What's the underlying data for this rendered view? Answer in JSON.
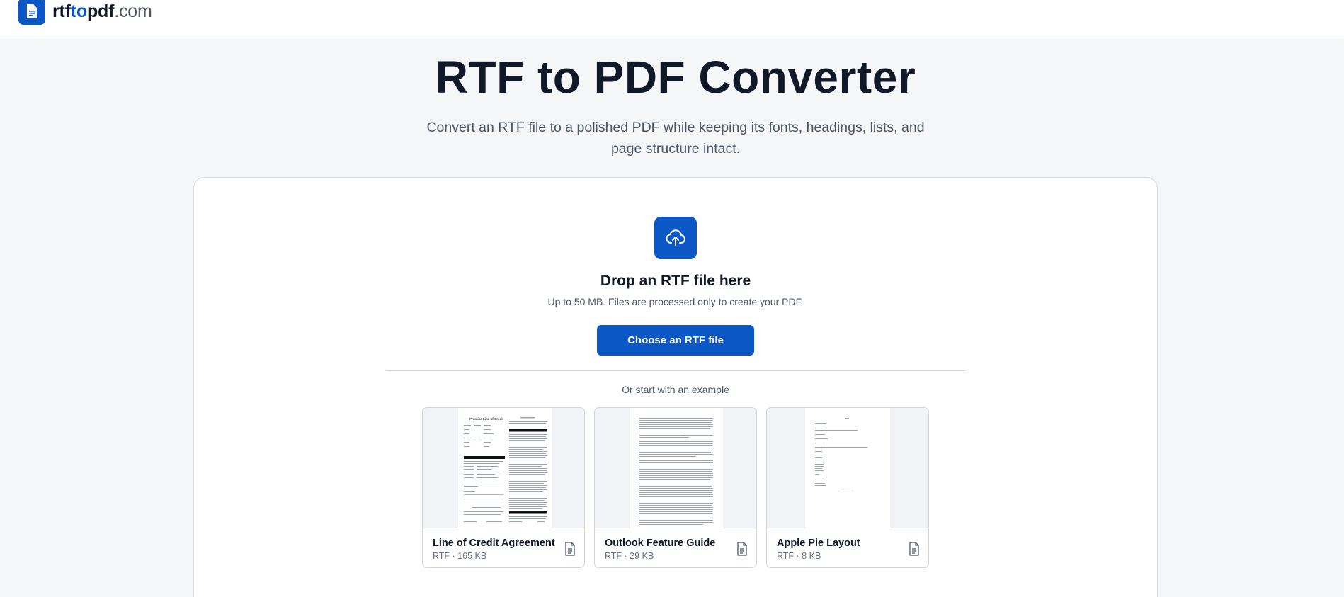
{
  "header": {
    "logo_icon": "document-icon",
    "logo_parts": [
      "rtf",
      "to",
      "pdf",
      ".com"
    ],
    "brand_color": "#0b57c5"
  },
  "hero": {
    "title": "RTF to PDF Converter",
    "subtitle": "Convert an RTF file to a polished PDF while keeping its fonts, headings, lists, and page structure intact."
  },
  "upload": {
    "icon": "cloud-upload-icon",
    "title": "Drop an RTF file here",
    "note": "Up to 50 MB. Files are processed only to create your PDF.",
    "button_label": "Choose an RTF file"
  },
  "examples": {
    "label": "Or start with an example",
    "items": [
      {
        "title": "Line of Credit Agreement",
        "meta": "RTF · 165 KB",
        "icon": "file-text-icon",
        "thumb_heading": "Promise Line of Credit"
      },
      {
        "title": "Outlook Feature Guide",
        "meta": "RTF · 29 KB",
        "icon": "file-text-icon"
      },
      {
        "title": "Apple Pie Layout",
        "meta": "RTF · 8 KB",
        "icon": "file-text-icon"
      }
    ]
  }
}
